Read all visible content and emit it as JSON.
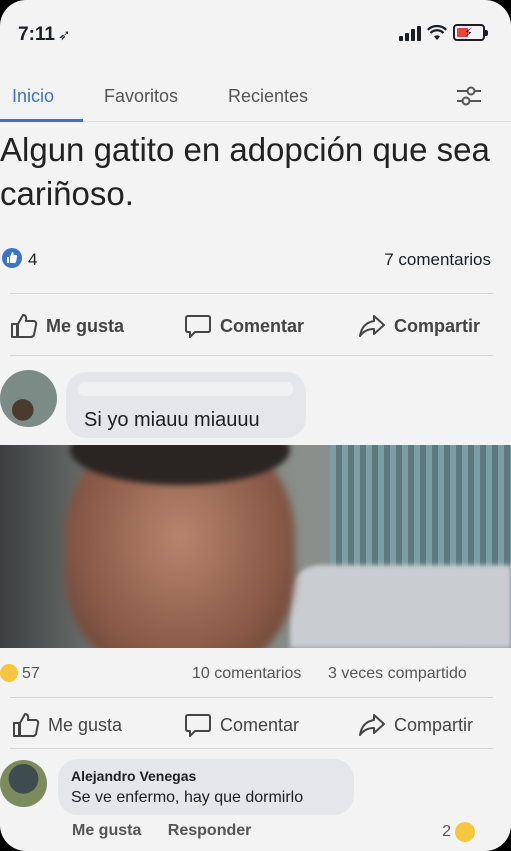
{
  "status_bar": {
    "time": "7:11",
    "time_arrow": "➶"
  },
  "tabs": [
    {
      "label": "Inicio",
      "active": true
    },
    {
      "label": "Favoritos",
      "active": false
    },
    {
      "label": "Recientes",
      "active": false
    }
  ],
  "post": {
    "text": "Algun gatito en adopción que sea cariñoso.",
    "likes": "4",
    "comments": "7 comentarios"
  },
  "actions": {
    "like": "Me gusta",
    "comment": "Comentar",
    "share": "Compartir"
  },
  "comment": {
    "text": "Si yo miauu miauuu"
  },
  "photo_post": {
    "reactions": "57",
    "comments": "10 comentarios",
    "shares": "3 veces compartido"
  },
  "reply": {
    "author": "Alejandro Venegas",
    "text": "Se ve enfermo, hay que dormirlo",
    "like_action": "Me gusta",
    "reply_action": "Responder",
    "reactions": "2"
  },
  "colors": {
    "accent": "#3b74c8",
    "haha": "#f7c640"
  }
}
